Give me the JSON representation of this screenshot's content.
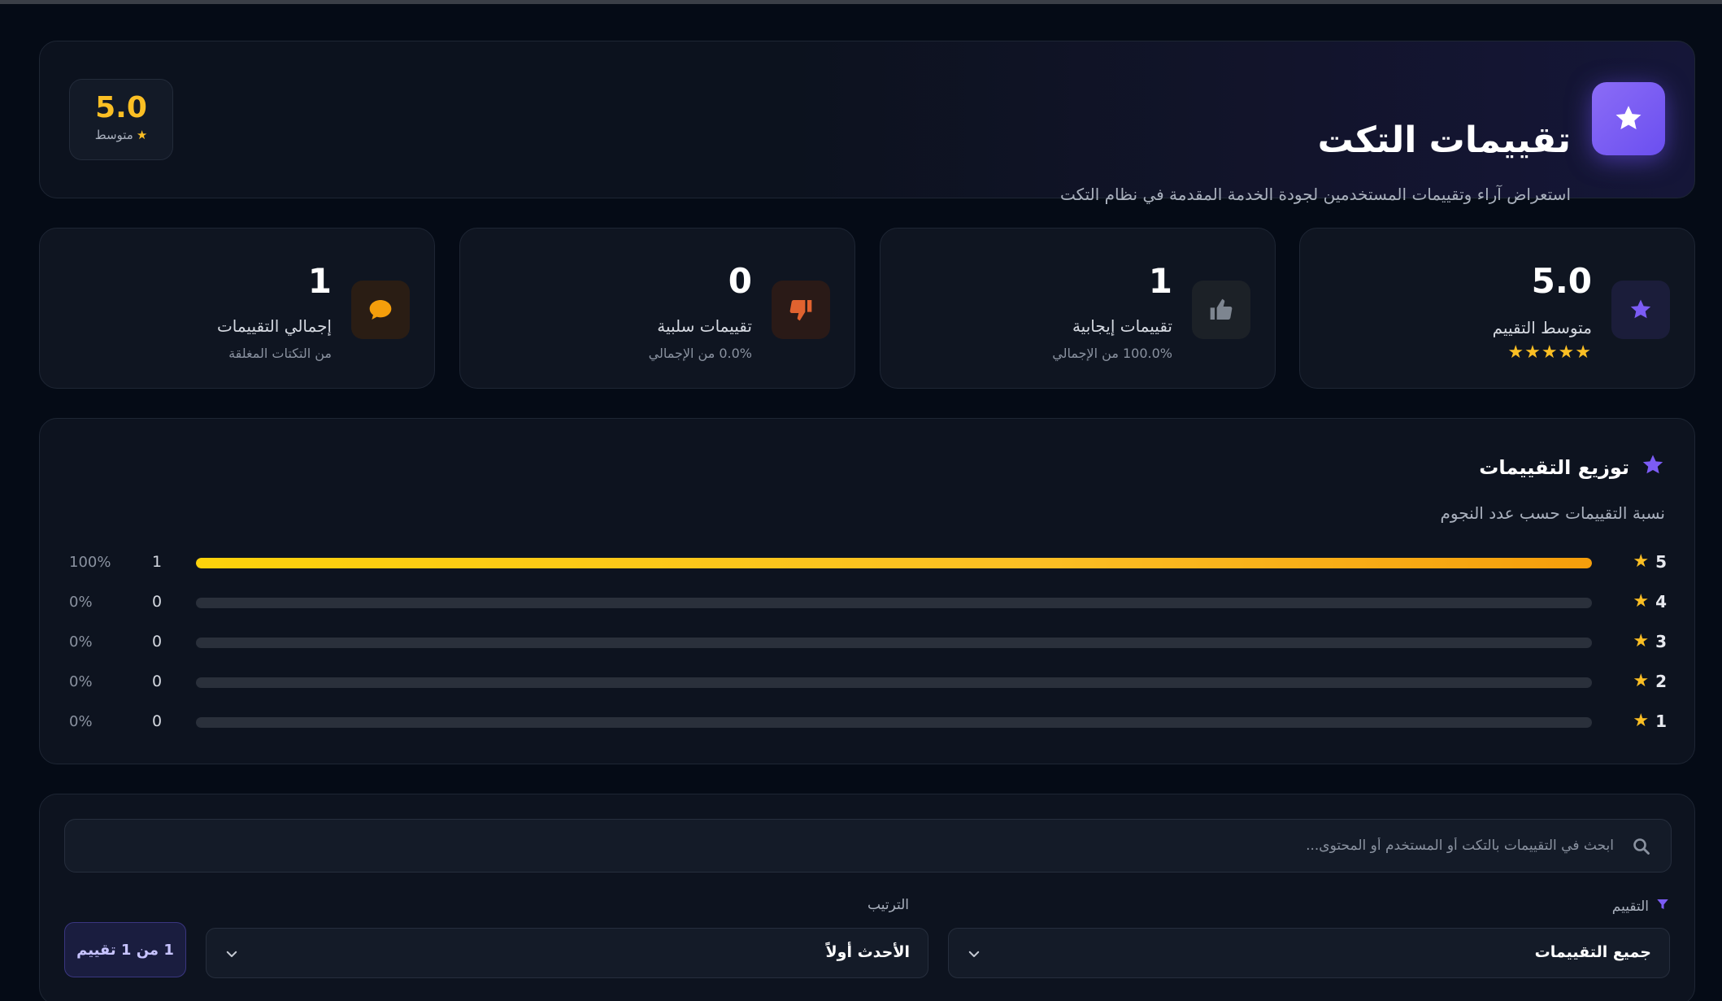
{
  "header": {
    "title": "تقييمات التكت",
    "subtitle": "استعراض آراء وتقييمات المستخدمين لجودة الخدمة المقدمة في نظام التكت",
    "average_value": "5.0",
    "average_label": "متوسط",
    "star_glyph": "★",
    "icon": "star-icon",
    "accent": "#7c5cf5"
  },
  "stats": [
    {
      "icon": "star-icon",
      "value": "5.0",
      "label": "متوسط التقييم",
      "stars": "★★★★★",
      "rating": 5
    },
    {
      "icon": "thumbs-up-icon",
      "value": "1",
      "label": "تقييمات إيجابية",
      "sub": "100.0% من الإجمالي"
    },
    {
      "icon": "thumbs-down-icon",
      "value": "0",
      "label": "تقييمات سلبية",
      "sub": "0.0% من الإجمالي"
    },
    {
      "icon": "chat-bubble-icon",
      "value": "1",
      "label": "إجمالي التقييمات",
      "sub": "من التكتات المغلقة"
    }
  ],
  "distribution": {
    "title": "توزيع التقييمات",
    "subtitle": "نسبة التقييمات حسب عدد النجوم",
    "rows": [
      {
        "stars": "5",
        "count": "1",
        "percent": "100%",
        "fraction": 1.0
      },
      {
        "stars": "4",
        "count": "0",
        "percent": "0%",
        "fraction": 0
      },
      {
        "stars": "3",
        "count": "0",
        "percent": "0%",
        "fraction": 0
      },
      {
        "stars": "2",
        "count": "0",
        "percent": "0%",
        "fraction": 0
      },
      {
        "stars": "1",
        "count": "0",
        "percent": "0%",
        "fraction": 0
      }
    ],
    "bar_color": "#fbbf24"
  },
  "filters": {
    "search_placeholder": "ابحث في التقييمات بالتكت أو المستخدم أو المحتوى...",
    "rating_label": "التقييم",
    "rating_value": "جميع التقييمات",
    "sort_label": "الترتيب",
    "sort_value": "الأحدث أولاً",
    "count_text": "1 من 1 تقييم"
  }
}
